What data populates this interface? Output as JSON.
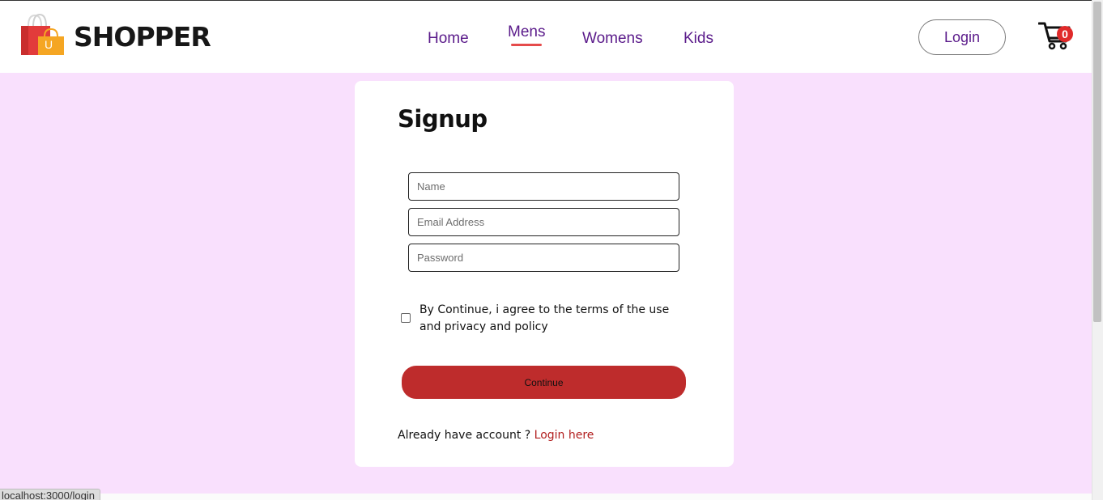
{
  "header": {
    "brand": "SHOPPER",
    "nav_items": [
      "Home",
      "Mens",
      "Womens",
      "Kids"
    ],
    "active_nav": "Mens",
    "login_label": "Login",
    "cart_count": "0",
    "logo_letter": "U"
  },
  "signup": {
    "title": "Signup",
    "name_placeholder": "Name",
    "email_placeholder": "Email Address",
    "password_placeholder": "Password",
    "agree_text": "By Continue, i agree to the terms of the use and privacy and policy",
    "continue_label": "Continue",
    "already_text": "Already have account ?",
    "login_link": "Login here"
  },
  "status_bar": {
    "url": "localhost:3000/login"
  },
  "colors": {
    "accent": "#be2c2c",
    "nav_text": "#5a1a8a",
    "page_bg": "#f9e0fd",
    "underline": "#e54b4b"
  },
  "icons": {
    "logo": "shopping-bags-icon",
    "cart": "cart-icon"
  }
}
